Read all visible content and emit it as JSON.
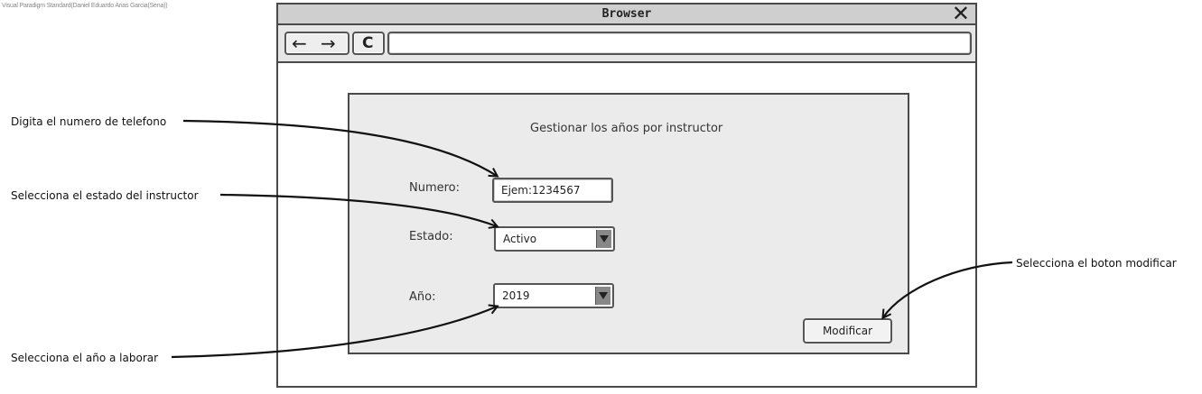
{
  "watermark": "Visual Paradigm Standard(Daniel Eduardo Arias Garcia(Sena))",
  "browser": {
    "title": "Browser",
    "close": "✕",
    "back": "←",
    "forward": "→",
    "reload": "C",
    "url": ""
  },
  "form": {
    "title": "Gestionar los años por instructor",
    "numero_label": "Numero:",
    "numero_placeholder": "Ejem:1234567",
    "estado_label": "Estado:",
    "estado_value": "Activo",
    "anio_label": "Año:",
    "anio_value": "2019",
    "modify_button": "Modificar"
  },
  "annotations": {
    "phone": "Digita el numero de telefono",
    "status": "Selecciona el estado del instructor",
    "year": "Selecciona el año a laborar",
    "modify": "Selecciona el boton modificar"
  }
}
